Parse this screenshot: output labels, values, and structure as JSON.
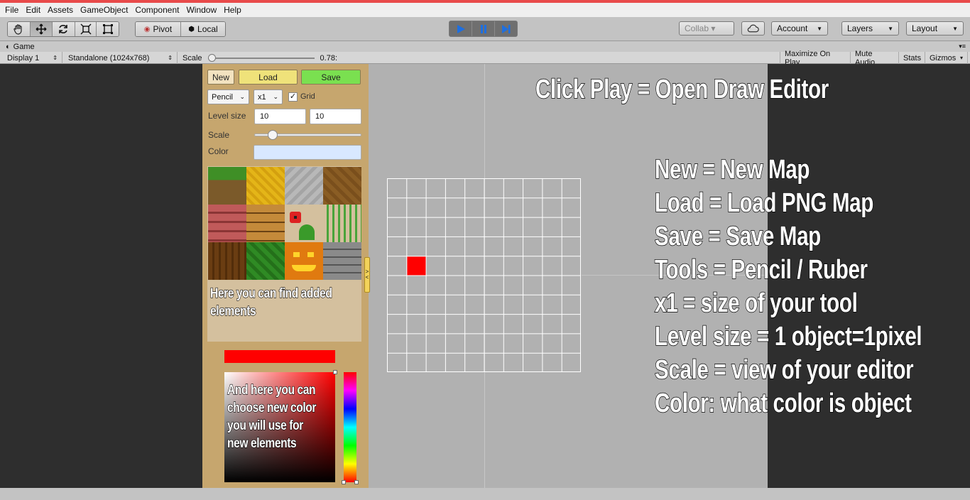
{
  "menu": [
    "File",
    "Edit",
    "Assets",
    "GameObject",
    "Component",
    "Window",
    "Help"
  ],
  "toolbar": {
    "transform_tools": [
      "hand-tool",
      "move-tool",
      "rotate-tool",
      "scale-tool",
      "rect-tool"
    ],
    "pivot_label": "Pivot",
    "local_label": "Local",
    "collab_label": "Collab ▾",
    "account_label": "Account",
    "layers_label": "Layers",
    "layout_label": "Layout"
  },
  "game_tab": {
    "title": "Game"
  },
  "game_bar": {
    "display": "Display 1",
    "resolution": "Standalone (1024x768)",
    "scale_label": "Scale",
    "scale_value": "0.78:",
    "maximize": "Maximize On Play",
    "mute": "Mute Audio",
    "stats": "Stats",
    "gizmos": "Gizmos"
  },
  "panel": {
    "new_label": "New",
    "load_label": "Load",
    "save_label": "Save",
    "tool_value": "Pencil",
    "size_value": "x1",
    "grid_label": "Grid",
    "grid_checked": true,
    "level_size_label": "Level size",
    "level_width": "10",
    "level_height": "10",
    "scale_label": "Scale",
    "scale_fraction": 0.14,
    "color_label": "Color",
    "color_value": "#d8e8ff",
    "elements_note": [
      "Here you can find added",
      "elements"
    ],
    "picker_note": [
      "And here you can",
      "choose new color",
      "you will use for",
      "new elements"
    ],
    "selected_color": "#ff0000",
    "collapse_handle": ">\n<"
  },
  "tiles": [
    "grass",
    "sand",
    "stone",
    "dirt",
    "brick",
    "wood-planks",
    "flower",
    "plant",
    "tree-bark",
    "leaves",
    "pumpkin",
    "cobblestone"
  ],
  "grid": {
    "cols": 10,
    "rows": 10,
    "filled_cells": [
      {
        "col": 1,
        "row": 4,
        "color": "#ff0000"
      }
    ]
  },
  "instructions": {
    "title": "Click Play = Open Draw Editor",
    "lines": [
      "New = New Map",
      "Load = Load PNG Map",
      "Save = Save Map",
      "Tools = Pencil / Ruber",
      "x1 = size of your tool",
      "Level size = 1 object=1pixel",
      "Scale = view of your editor",
      "Color: what color is object"
    ]
  }
}
